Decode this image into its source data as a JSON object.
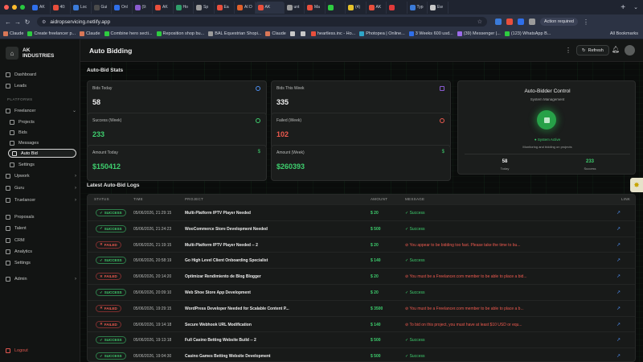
{
  "browser": {
    "tabs": [
      {
        "label": "AK",
        "color": "#2f6fea"
      },
      {
        "label": "40:",
        "color": "#e94f3c"
      },
      {
        "label": "Loc",
        "color": "#3b7bd9"
      },
      {
        "label": "Gui",
        "color": "#4a4a4a"
      },
      {
        "label": "Onl",
        "color": "#2f6fea"
      },
      {
        "label": "(9:",
        "color": "#8a5cd0"
      },
      {
        "label": "AK",
        "color": "#e94f3c"
      },
      {
        "label": "Ho",
        "color": "#2f9e6a"
      },
      {
        "label": "Sp",
        "color": "#9b9b9b"
      },
      {
        "label": "Ea",
        "color": "#e94f3c"
      },
      {
        "label": "AI D",
        "color": "#e0602b"
      },
      {
        "label": "AK",
        "color": "#e94f3c",
        "active": true
      },
      {
        "label": "unt",
        "color": "#9b9b9b"
      },
      {
        "label": "Ma",
        "color": "#e94f3c"
      },
      {
        "label": "",
        "color": "#2ecc40"
      },
      {
        "label": "(4)",
        "color": "#e6c229"
      },
      {
        "label": "AK",
        "color": "#e94f3c"
      },
      {
        "label": "",
        "color": "#e03a3a"
      },
      {
        "label": "Typ",
        "color": "#3b7bd9"
      },
      {
        "label": "Ew",
        "color": "#c8c8c8"
      }
    ],
    "url": "aidropservicing.netlify.app",
    "action_required": "Action required",
    "bookmarks": [
      {
        "label": "Claude",
        "color": "#d97757"
      },
      {
        "label": "Create freelancer p...",
        "color": "#2ecc40"
      },
      {
        "label": "Claude",
        "color": "#d97757"
      },
      {
        "label": "Combine hero secti...",
        "color": "#2ecc40"
      },
      {
        "label": "Reposition shop bu...",
        "color": "#2ecc40"
      },
      {
        "label": "BAL Equestrian Shopi...",
        "color": "#9b9b9b"
      },
      {
        "label": "Claude",
        "color": "#d97757"
      },
      {
        "label": "",
        "color": "#c8c8c8"
      },
      {
        "label": "",
        "color": "#c8c8c8"
      },
      {
        "label": "heartless.inc - Ho...",
        "color": "#e94f3c"
      },
      {
        "label": "Photopea | Online...",
        "color": "#2fa6c9"
      },
      {
        "label": "3 Weeks  600 usd...",
        "color": "#2f6fea"
      },
      {
        "label": "(39) Messenger |...",
        "color": "#9b6bea"
      },
      {
        "label": "(123) WhatsApp B...",
        "color": "#2ecc40"
      }
    ],
    "all_bookmarks": "All Bookmarks"
  },
  "sidebar": {
    "brand_line1": "AK",
    "brand_line2": "INDUSTRIES",
    "dashboard": "Dashboard",
    "leads": "Leads",
    "platforms_header": "PLATFORMS",
    "freelancer": "Freelancer",
    "projects": "Projects",
    "bids": "Bids",
    "messages": "Messages",
    "auto_bid": "Auto Bid",
    "settings_sub": "Settings",
    "upwork": "Upwork",
    "guru": "Guru",
    "truelancer": "Truelancer",
    "proposals": "Proposals",
    "talent": "Talent",
    "crm": "CRM",
    "analytics": "Analytics",
    "settings": "Settings",
    "admin": "Admin",
    "logout": "Logout"
  },
  "header": {
    "title": "Auto Bidding",
    "refresh": "Refresh"
  },
  "stats": {
    "section_title": "Auto-Bid Stats",
    "bids_today_label": "Bids Today",
    "bids_today": "58",
    "bids_week_label": "Bids This Week",
    "bids_week": "335",
    "success_label": "Success (Week)",
    "success": "233",
    "failed_label": "Failed (Week)",
    "failed": "102",
    "amount_today_label": "Amount Today",
    "amount_today": "$150412",
    "amount_week_label": "Amount (Week)",
    "amount_week": "$260393",
    "dollar": "$"
  },
  "control": {
    "title": "Auto-Bidder Control",
    "subtitle": "System Management",
    "status": "System Active",
    "note": "Monitoring and bidding on projects",
    "today_value": "58",
    "today_label": "Today",
    "success_value": "233",
    "success_label": "Success"
  },
  "logs": {
    "section_title": "Latest Auto-Bid Logs",
    "columns": {
      "status": "STATUS",
      "time": "TIME",
      "project": "PROJECT",
      "amount": "AMOUNT",
      "message": "MESSAGE",
      "link": "LINK"
    },
    "rows": [
      {
        "status": "SUCCESS",
        "ok": true,
        "time": "05/06/2026, 21:29:15",
        "project": "Multi-Platform IPTV Player Needed",
        "amount": "$ 20",
        "message": "Success"
      },
      {
        "status": "SUCCESS",
        "ok": true,
        "time": "05/06/2026, 21:24:23",
        "project": "WooCommerce Store Development Needed",
        "amount": "$ 500",
        "message": "Success"
      },
      {
        "status": "FAILED",
        "ok": false,
        "time": "05/06/2026, 21:19:15",
        "project": "Multi-Platform IPTV Player Needed -- 2",
        "amount": "$ 20",
        "message": "You appear to be bidding too fast. Please take the time to bu..."
      },
      {
        "status": "SUCCESS",
        "ok": true,
        "time": "05/06/2026, 20:58:19",
        "project": "Go High Level Client Onboarding Specialist",
        "amount": "$ 140",
        "message": "Success"
      },
      {
        "status": "FAILED",
        "ok": false,
        "time": "05/06/2026, 20:14:20",
        "project": "Optimizar Rendimiento de Blog Blogger",
        "amount": "$ 20",
        "message": "You must be a Freelancer.com member to be able to place a bid..."
      },
      {
        "status": "SUCCESS",
        "ok": true,
        "time": "05/06/2026, 20:09:10",
        "project": "Web Shoe Store App Development",
        "amount": "$ 20",
        "message": "Success"
      },
      {
        "status": "FAILED",
        "ok": false,
        "time": "05/06/2026, 19:29:15",
        "project": "WordPress Developer Needed for Scalable Content P...",
        "amount": "$ 3500",
        "message": "You must be a Freelancer.com member to be able to place a b..."
      },
      {
        "status": "FAILED",
        "ok": false,
        "time": "05/06/2026, 19:14:18",
        "project": "Secure Webhook URL Modification",
        "amount": "$ 140",
        "message": "To bid on this project, you must have at least $10 USD or equ..."
      },
      {
        "status": "SUCCESS",
        "ok": true,
        "time": "05/06/2026, 19:13:18",
        "project": "Full Casino Betting Website Build -- 2",
        "amount": "$ 500",
        "message": "Success"
      },
      {
        "status": "SUCCESS",
        "ok": true,
        "time": "05/06/2026, 19:04:30",
        "project": "Casino Games Betting Website Development",
        "amount": "$ 500",
        "message": "Success"
      }
    ]
  },
  "colors": {
    "accent_green": "#3ecf6e",
    "accent_red": "#ef5a4f",
    "link_blue": "#4d8ef0"
  }
}
